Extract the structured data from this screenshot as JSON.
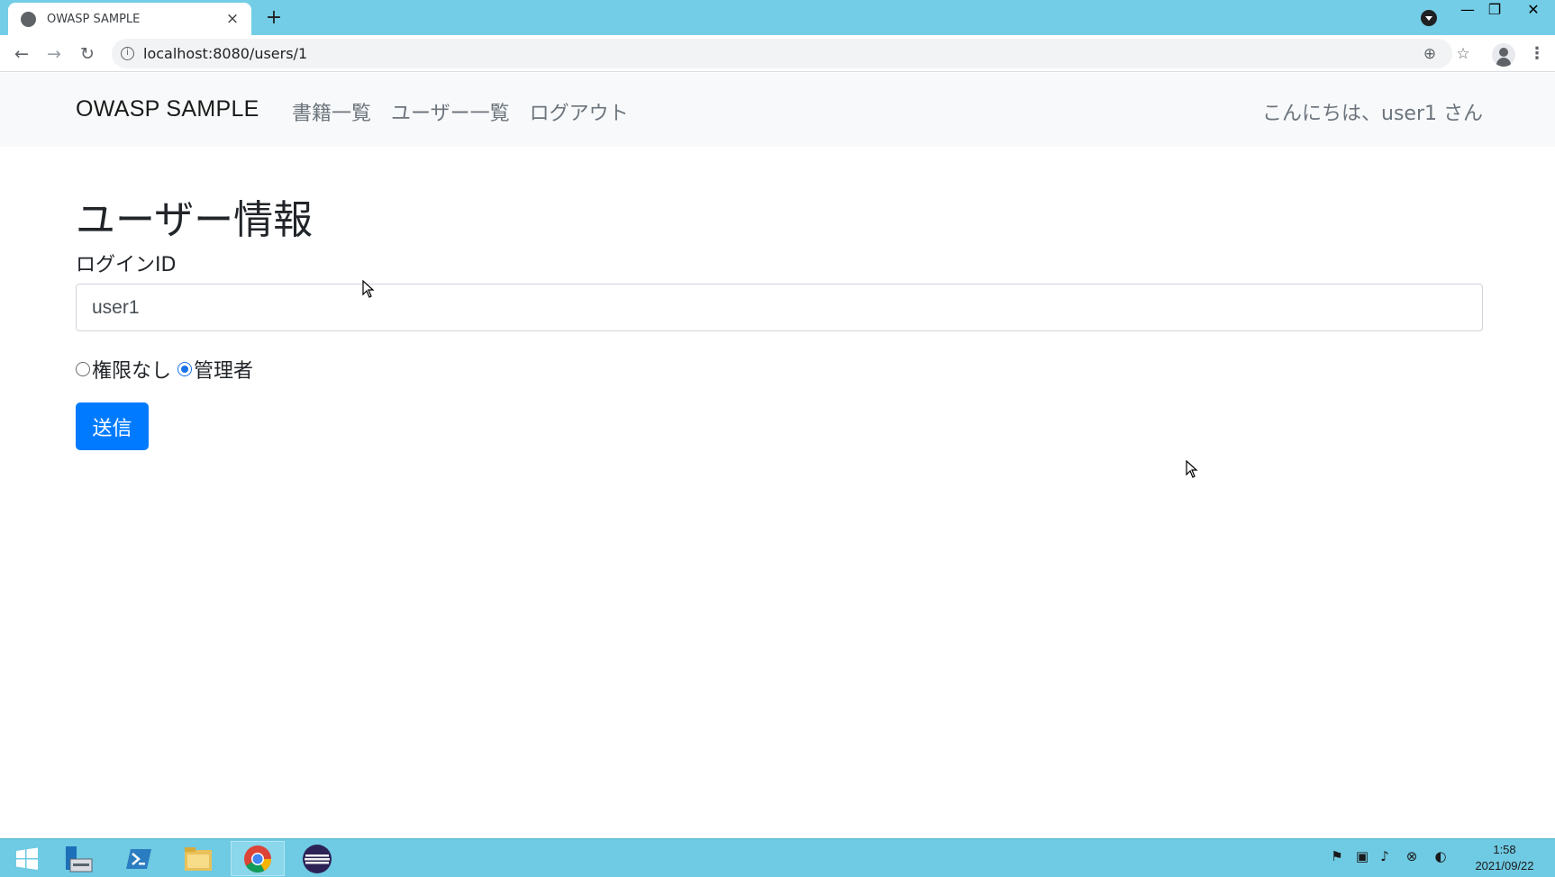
{
  "browser": {
    "tab_title": "OWASP SAMPLE",
    "tab_close": "×",
    "new_tab": "+",
    "url": "localhost:8080/users/1",
    "back": "←",
    "forward": "→",
    "reload": "↻",
    "zoom": "⊕",
    "star": "☆",
    "menu": "⋮",
    "info": "i",
    "window": {
      "minimize": "—",
      "maximize": "❐",
      "close": "✕"
    }
  },
  "navbar": {
    "brand": "OWASP SAMPLE",
    "links": [
      "書籍一覧",
      "ユーザー一覧",
      "ログアウト"
    ],
    "greeting": "こんにちは、user1 さん"
  },
  "form": {
    "title": "ユーザー情報",
    "login_id_label": "ログインID",
    "login_id_value": "user1",
    "roles": [
      {
        "label": "権限なし",
        "checked": false
      },
      {
        "label": "管理者",
        "checked": true
      }
    ],
    "submit_label": "送信"
  },
  "taskbar": {
    "time": "1:58",
    "date": "2021/09/22"
  },
  "colors": {
    "titlebar": "#74cde6",
    "taskbar": "#6fcae3",
    "primary_button": "#007bff",
    "navbar_bg": "#f8f9fa",
    "nav_link": "#6c757d"
  },
  "icons": {
    "start": "windows-logo-icon",
    "server_manager": "server-manager-icon",
    "powershell": "powershell-icon",
    "file_explorer": "folder-icon",
    "chrome": "chrome-icon",
    "eclipse": "eclipse-icon"
  }
}
